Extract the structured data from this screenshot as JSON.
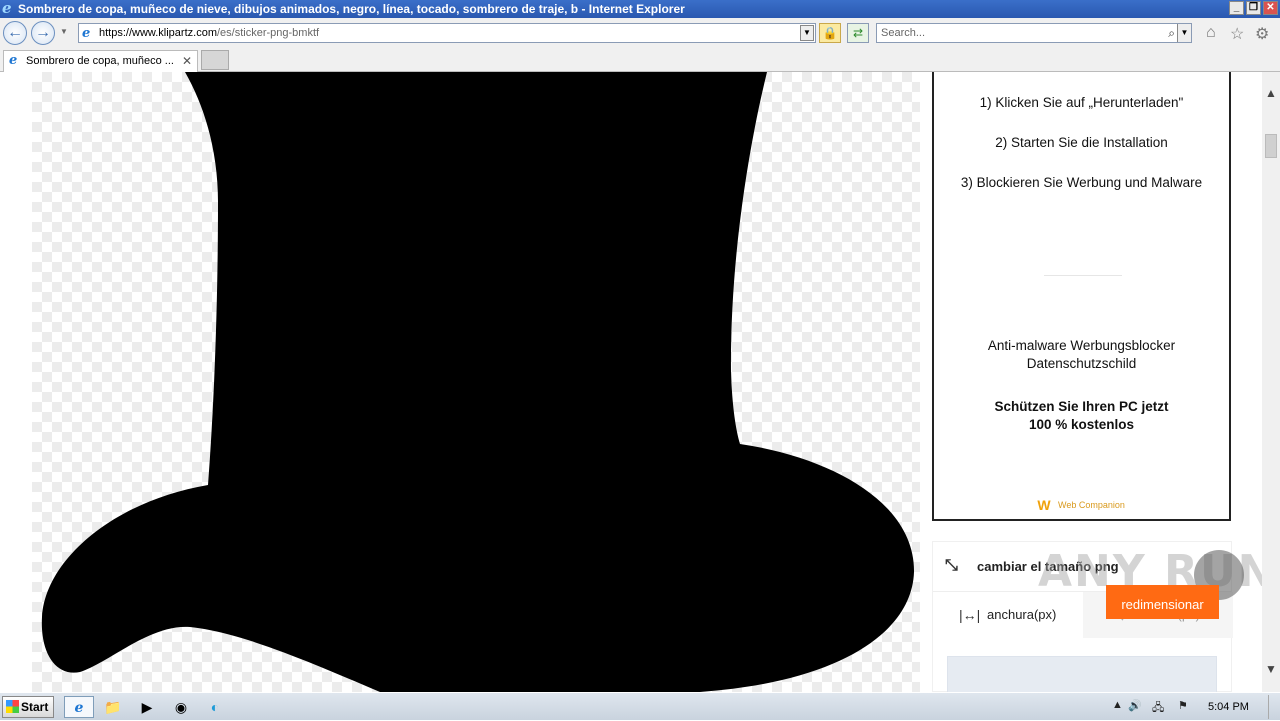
{
  "window": {
    "title": "Sombrero de copa, muñeco de nieve, dibujos animados, negro, línea, tocado, sombrero de traje, b - Internet Explorer",
    "minimize": "_",
    "restore": "❐",
    "close": "✕"
  },
  "toolbar": {
    "back": "←",
    "forward": "→",
    "address_scheme_host": "https://www.klipartz.com",
    "address_path": "/es/sticker-png-bmktf",
    "search_placeholder": "Search..."
  },
  "tabs": [
    {
      "label": "Sombrero de copa, muñeco ..."
    }
  ],
  "ad": {
    "steps": [
      "1) Klicken Sie auf „Herunterladen\"",
      "2) Starten Sie die Installation",
      "3) Blockieren Sie Werbung und Malware"
    ],
    "tagline_line1": "Anti-malware Werbungsblocker",
    "tagline_line2": "Datenschutzschild",
    "cta_line1": "Schützen Sie Ihren PC jetzt",
    "cta_line2": "100 % kostenlos",
    "brand": "Web Companion"
  },
  "resize_panel": {
    "title": "cambiar el tamaño png",
    "width_tab": "anchura(px)",
    "height_tab": "altura(px)",
    "resize_button": "redimensionar"
  },
  "watermark": "ANY RUN",
  "taskbar": {
    "start": "Start",
    "clock": "5:04 PM"
  },
  "colors": {
    "accent": "#ff6a13",
    "titlebar": "#2a58b0"
  }
}
